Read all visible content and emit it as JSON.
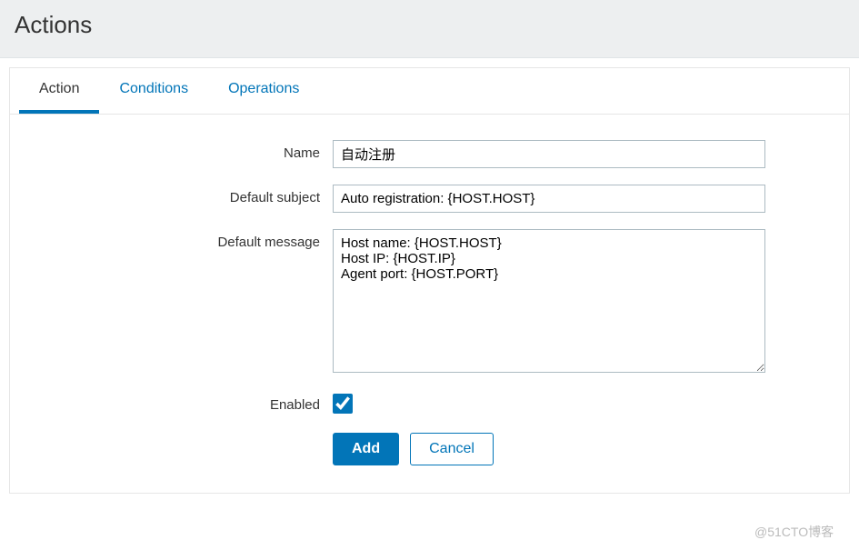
{
  "header": {
    "title": "Actions"
  },
  "tabs": [
    {
      "label": "Action",
      "active": true
    },
    {
      "label": "Conditions",
      "active": false
    },
    {
      "label": "Operations",
      "active": false
    }
  ],
  "form": {
    "name": {
      "label": "Name",
      "value": "自动注册"
    },
    "default_subject": {
      "label": "Default subject",
      "value": "Auto registration: {HOST.HOST}"
    },
    "default_message": {
      "label": "Default message",
      "value": "Host name: {HOST.HOST}\nHost IP: {HOST.IP}\nAgent port: {HOST.PORT}"
    },
    "enabled": {
      "label": "Enabled",
      "checked": true
    }
  },
  "buttons": {
    "add": "Add",
    "cancel": "Cancel"
  },
  "watermark": "@51CTO博客"
}
